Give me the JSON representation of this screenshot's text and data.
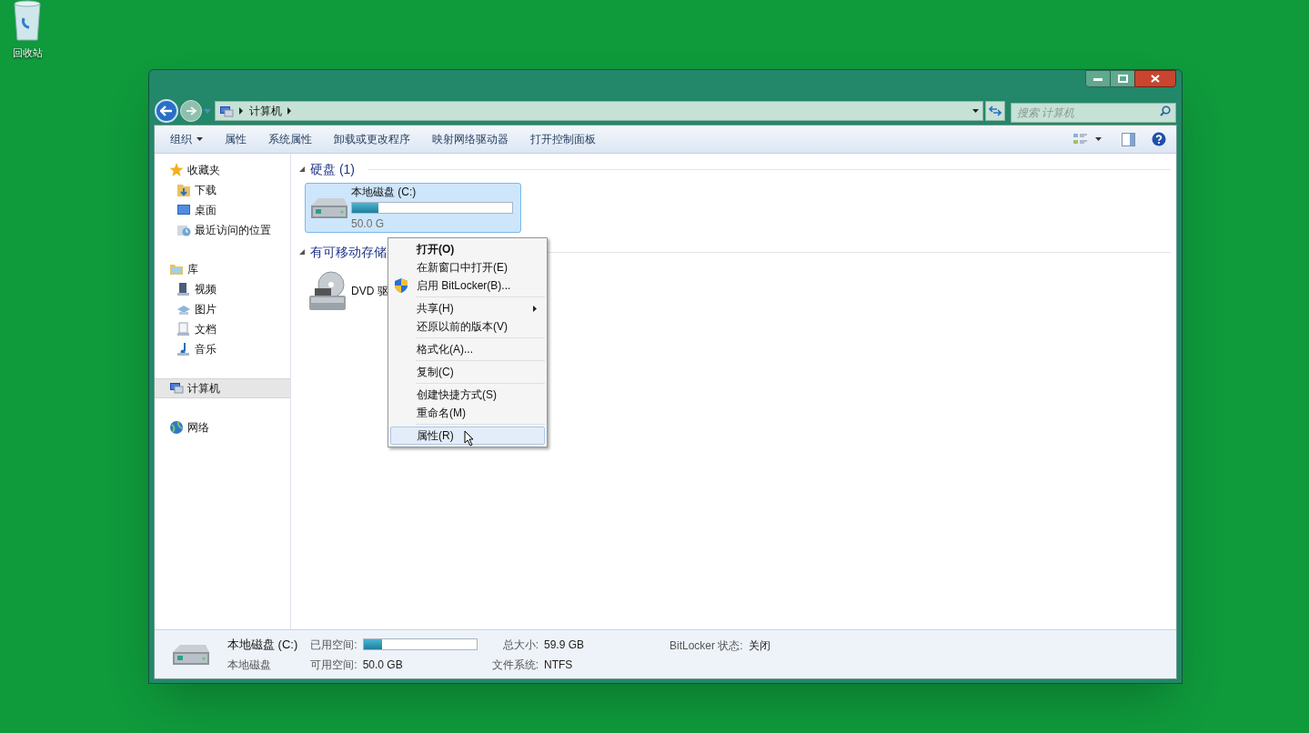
{
  "desktop_icons": [
    {
      "label": "回收站"
    }
  ],
  "window": {
    "crumbs": [
      "计算机"
    ],
    "search": {
      "placeholder": "搜索 计算机"
    }
  },
  "toolbar": [
    {
      "label": "组织",
      "dropdown": true
    },
    {
      "label": "属性",
      "dropdown": false
    },
    {
      "label": "系统属性",
      "dropdown": false
    },
    {
      "label": "卸载或更改程序",
      "dropdown": false
    },
    {
      "label": "映射网络驱动器",
      "dropdown": false
    },
    {
      "label": "打开控制面板",
      "dropdown": false
    }
  ],
  "sidebar": [
    {
      "label": "收藏夹",
      "selected": false,
      "children": [
        {
          "label": "下载",
          "selected": false
        },
        {
          "label": "桌面",
          "selected": false
        },
        {
          "label": "最近访问的位置",
          "selected": false
        }
      ]
    },
    {
      "label": "库",
      "selected": false,
      "children": [
        {
          "label": "视频",
          "selected": false
        },
        {
          "label": "图片",
          "selected": false
        },
        {
          "label": "文档",
          "selected": false
        },
        {
          "label": "音乐",
          "selected": false
        }
      ]
    },
    {
      "label": "计算机",
      "selected": true
    },
    {
      "label": "网络",
      "selected": false
    }
  ],
  "groups": [
    {
      "title": "硬盘 (1)",
      "items": [
        {
          "kind": "drive",
          "name": "本地磁盘 (C:)",
          "level": 0.165,
          "detail": "50.0 G",
          "selected": true
        }
      ]
    },
    {
      "title": "有可移动存储",
      "items": [
        {
          "kind": "dvd",
          "name": "DVD 驱",
          "selected": false
        }
      ]
    }
  ],
  "context_menu": [
    [
      {
        "label": "打开(O)",
        "default": true,
        "submenu": false,
        "selected": false
      },
      {
        "label": "在新窗口中打开(E)",
        "default": false,
        "submenu": false,
        "selected": false
      },
      {
        "label": "启用 BitLocker(B)...",
        "kind": "shield",
        "default": false,
        "submenu": false,
        "selected": false
      }
    ],
    [
      {
        "label": "共享(H)",
        "default": false,
        "submenu": true,
        "selected": false
      },
      {
        "label": "还原以前的版本(V)",
        "default": false,
        "submenu": false,
        "selected": false
      }
    ],
    [
      {
        "label": "格式化(A)...",
        "default": false,
        "submenu": false,
        "selected": false
      }
    ],
    [
      {
        "label": "复制(C)",
        "default": false,
        "submenu": false,
        "selected": false
      }
    ],
    [
      {
        "label": "创建快捷方式(S)",
        "default": false,
        "submenu": false,
        "selected": false
      },
      {
        "label": "重命名(M)",
        "default": false,
        "submenu": false,
        "selected": false
      }
    ],
    [
      {
        "label": "属性(R)",
        "default": false,
        "submenu": false,
        "selected": true
      }
    ]
  ],
  "details": {
    "name": "本地磁盘 (C:)",
    "type": "本地磁盘",
    "used_label": "已用空间:",
    "level": 0.165,
    "free_label": "可用空间:",
    "free": "50.0 GB",
    "total_label": "总大小:",
    "total": "59.9 GB",
    "fs_label": "文件系统:",
    "fs": "NTFS",
    "bitlocker_label": "BitLocker 状态:",
    "bitlocker": "关闭"
  }
}
